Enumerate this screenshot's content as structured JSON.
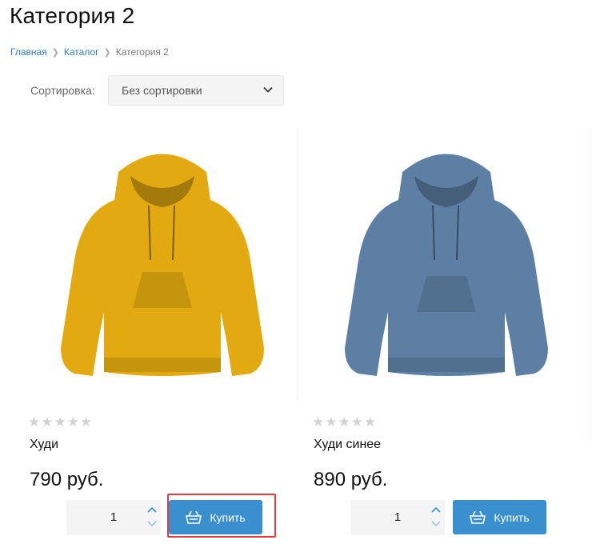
{
  "page": {
    "title": "Категория 2"
  },
  "breadcrumb": {
    "items": [
      "Главная",
      "Каталог",
      "Категория 2"
    ]
  },
  "sort": {
    "label": "Сортировка:",
    "selected": "Без сортировки"
  },
  "products": [
    {
      "name": "Худи",
      "price": "790 руб.",
      "rating": 0,
      "quantity": "1",
      "buy_label": "Купить",
      "color": "#e2aa10"
    },
    {
      "name": "Худи синее",
      "price": "890 руб.",
      "rating": 0,
      "quantity": "1",
      "buy_label": "Купить",
      "color": "#5d7fa3"
    }
  ],
  "icons": {
    "star": "★",
    "breadcrumb_separator": "chevron-right-icon",
    "basket": "basket-icon"
  },
  "colors": {
    "accent": "#3a8fcf",
    "highlight": "#e8393f",
    "link": "#2e7dbf"
  }
}
